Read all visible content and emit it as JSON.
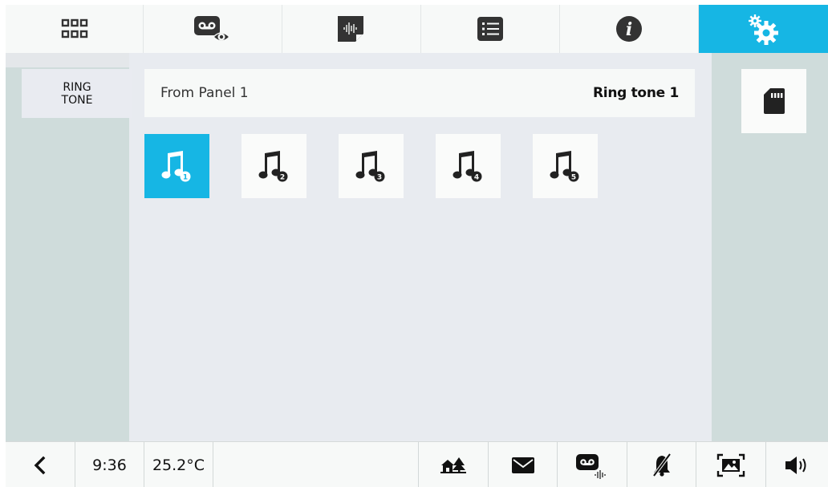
{
  "colors": {
    "accent": "#16b6e4",
    "panel": "#cfdcdb",
    "main": "#e8ebf0",
    "tile": "#fafbfa"
  },
  "top_nav": {
    "tabs": [
      {
        "icon": "grid-icon",
        "active": false
      },
      {
        "icon": "video-memo-view-icon",
        "active": false
      },
      {
        "icon": "voice-memo-icon",
        "active": false
      },
      {
        "icon": "list-icon",
        "active": false
      },
      {
        "icon": "info-icon",
        "active": false
      },
      {
        "icon": "settings-gears-icon",
        "active": true
      }
    ]
  },
  "settings": {
    "section_label": "RING\nTONE",
    "source": "From Panel 1",
    "selected_tone": "Ring tone 1",
    "tone_options": [
      {
        "icon": "music-note-icon",
        "number": "1",
        "selected": true
      },
      {
        "icon": "music-note-icon",
        "number": "2",
        "selected": false
      },
      {
        "icon": "music-note-icon",
        "number": "3",
        "selected": false
      },
      {
        "icon": "music-note-icon",
        "number": "4",
        "selected": false
      },
      {
        "icon": "music-note-icon",
        "number": "5",
        "selected": false
      }
    ],
    "sd_card_icon": "sd-card-icon"
  },
  "bottom_bar": {
    "back_icon": "back-chevron-icon",
    "time": "9:36",
    "temperature": "25.2°C",
    "status_icons": [
      "home-tree-icon",
      "envelope-icon",
      "voicemail-icon",
      "bell-muted-icon",
      "picture-frame-icon",
      "speaker-volume-icon"
    ]
  }
}
